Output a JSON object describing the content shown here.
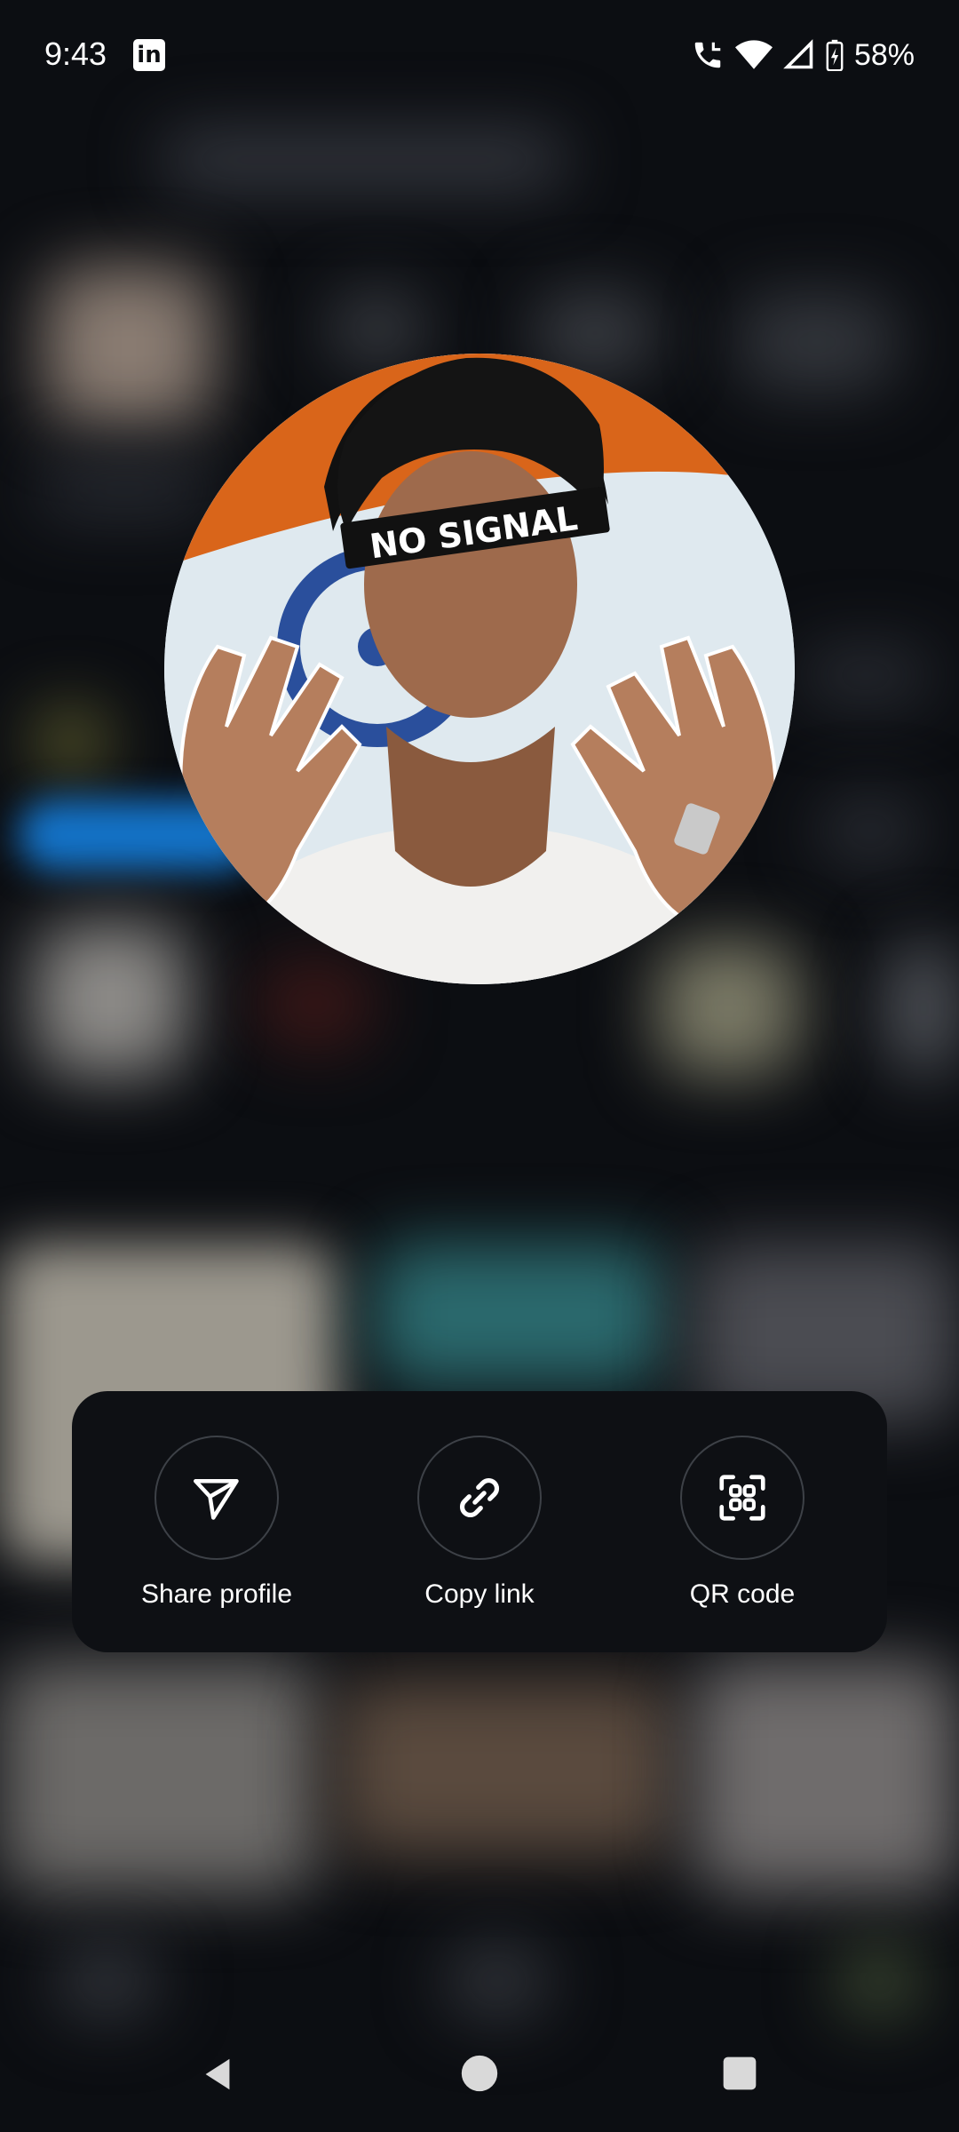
{
  "status_bar": {
    "time": "9:43",
    "app_notification_icon": "linkedin-icon",
    "battery_percent": "58%",
    "icons": [
      "call-icon",
      "wifi-icon",
      "signal-icon",
      "battery-charging-icon"
    ]
  },
  "profile_preview": {
    "avatar_caption": "NO SIGNAL"
  },
  "share_sheet": {
    "actions": [
      {
        "label": "Share profile",
        "icon": "send-icon"
      },
      {
        "label": "Copy link",
        "icon": "link-icon"
      },
      {
        "label": "QR code",
        "icon": "qr-code-icon"
      }
    ]
  },
  "nav_bar": {
    "buttons": [
      "back-icon",
      "home-icon",
      "recents-icon"
    ]
  },
  "colors": {
    "background": "#0c0e12",
    "card": "#0e1014",
    "circle_border": "#3d4147",
    "text": "#ffffff"
  }
}
